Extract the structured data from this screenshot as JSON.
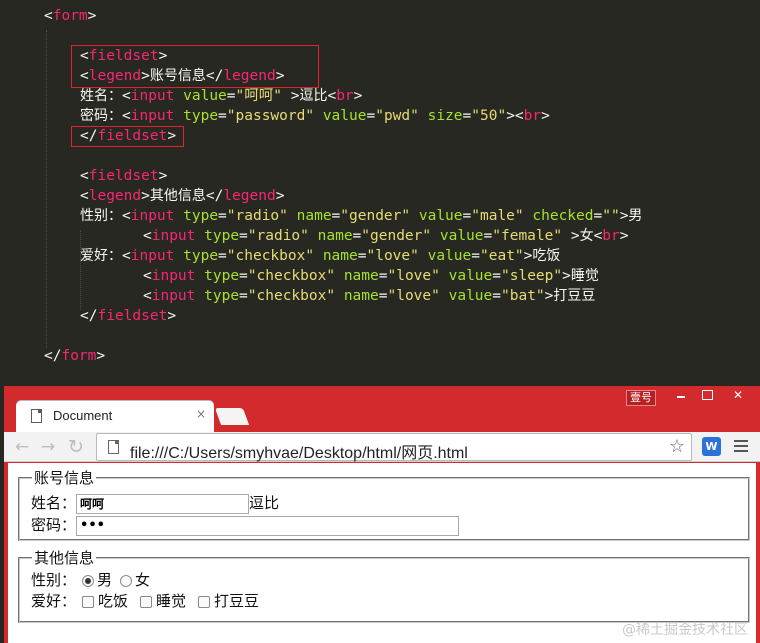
{
  "editor": {
    "lines": [
      {
        "parts": [
          [
            "p",
            "<"
          ],
          [
            "t",
            "form"
          ],
          [
            "p",
            ">"
          ]
        ]
      },
      {
        "parts": []
      },
      {
        "parts": [
          [
            "p",
            "<"
          ],
          [
            "t",
            "fieldset"
          ],
          [
            "p",
            ">"
          ]
        ]
      },
      {
        "parts": [
          [
            "p",
            "<"
          ],
          [
            "t",
            "legend"
          ],
          [
            "p",
            ">"
          ],
          [
            "tx",
            "账号信息"
          ],
          [
            "p",
            "</"
          ],
          [
            "t",
            "legend"
          ],
          [
            "p",
            ">"
          ]
        ]
      },
      {
        "parts": [
          [
            "tx",
            "姓名："
          ],
          [
            "p",
            "<"
          ],
          [
            "t",
            "input"
          ],
          [
            "p",
            " "
          ],
          [
            "a",
            "value"
          ],
          [
            "p",
            "="
          ],
          [
            "s",
            "\"呵呵\""
          ],
          [
            "p",
            " >"
          ],
          [
            "tx",
            "逗比"
          ],
          [
            "p",
            "<"
          ],
          [
            "t",
            "br"
          ],
          [
            "p",
            ">"
          ]
        ]
      },
      {
        "parts": [
          [
            "tx",
            "密码："
          ],
          [
            "p",
            "<"
          ],
          [
            "t",
            "input"
          ],
          [
            "p",
            " "
          ],
          [
            "a",
            "type"
          ],
          [
            "p",
            "="
          ],
          [
            "s",
            "\"password\""
          ],
          [
            "p",
            " "
          ],
          [
            "a",
            "value"
          ],
          [
            "p",
            "="
          ],
          [
            "s",
            "\"pwd\""
          ],
          [
            "p",
            " "
          ],
          [
            "a",
            "size"
          ],
          [
            "p",
            "="
          ],
          [
            "s",
            "\"50\""
          ],
          [
            "p",
            "><"
          ],
          [
            "t",
            "br"
          ],
          [
            "p",
            ">"
          ]
        ]
      },
      {
        "parts": [
          [
            "p",
            "</"
          ],
          [
            "t",
            "fieldset"
          ],
          [
            "p",
            ">"
          ]
        ]
      },
      {
        "parts": []
      },
      {
        "parts": [
          [
            "p",
            "<"
          ],
          [
            "t",
            "fieldset"
          ],
          [
            "p",
            ">"
          ]
        ]
      },
      {
        "parts": [
          [
            "p",
            "<"
          ],
          [
            "t",
            "legend"
          ],
          [
            "p",
            ">"
          ],
          [
            "tx",
            "其他信息"
          ],
          [
            "p",
            "</"
          ],
          [
            "t",
            "legend"
          ],
          [
            "p",
            ">"
          ]
        ]
      },
      {
        "parts": [
          [
            "tx",
            "性别："
          ],
          [
            "p",
            "<"
          ],
          [
            "t",
            "input"
          ],
          [
            "p",
            " "
          ],
          [
            "a",
            "type"
          ],
          [
            "p",
            "="
          ],
          [
            "s",
            "\"radio\""
          ],
          [
            "p",
            " "
          ],
          [
            "a",
            "name"
          ],
          [
            "p",
            "="
          ],
          [
            "s",
            "\"gender\""
          ],
          [
            "p",
            " "
          ],
          [
            "a",
            "value"
          ],
          [
            "p",
            "="
          ],
          [
            "s",
            "\"male\""
          ],
          [
            "p",
            " "
          ],
          [
            "a",
            "checked"
          ],
          [
            "p",
            "="
          ],
          [
            "s",
            "\"\""
          ],
          [
            "p",
            ">"
          ],
          [
            "tx",
            "男"
          ]
        ]
      },
      {
        "parts": [
          [
            "p",
            "<"
          ],
          [
            "t",
            "input"
          ],
          [
            "p",
            " "
          ],
          [
            "a",
            "type"
          ],
          [
            "p",
            "="
          ],
          [
            "s",
            "\"radio\""
          ],
          [
            "p",
            " "
          ],
          [
            "a",
            "name"
          ],
          [
            "p",
            "="
          ],
          [
            "s",
            "\"gender\""
          ],
          [
            "p",
            " "
          ],
          [
            "a",
            "value"
          ],
          [
            "p",
            "="
          ],
          [
            "s",
            "\"female\""
          ],
          [
            "p",
            " >"
          ],
          [
            "tx",
            "女"
          ],
          [
            "p",
            "<"
          ],
          [
            "t",
            "br"
          ],
          [
            "p",
            ">"
          ]
        ]
      },
      {
        "parts": [
          [
            "tx",
            "爱好："
          ],
          [
            "p",
            "<"
          ],
          [
            "t",
            "input"
          ],
          [
            "p",
            " "
          ],
          [
            "a",
            "type"
          ],
          [
            "p",
            "="
          ],
          [
            "s",
            "\"checkbox\""
          ],
          [
            "p",
            " "
          ],
          [
            "a",
            "name"
          ],
          [
            "p",
            "="
          ],
          [
            "s",
            "\"love\""
          ],
          [
            "p",
            " "
          ],
          [
            "a",
            "value"
          ],
          [
            "p",
            "="
          ],
          [
            "s",
            "\"eat\""
          ],
          [
            "p",
            ">"
          ],
          [
            "tx",
            "吃饭"
          ]
        ]
      },
      {
        "parts": [
          [
            "p",
            "<"
          ],
          [
            "t",
            "input"
          ],
          [
            "p",
            " "
          ],
          [
            "a",
            "type"
          ],
          [
            "p",
            "="
          ],
          [
            "s",
            "\"checkbox\""
          ],
          [
            "p",
            " "
          ],
          [
            "a",
            "name"
          ],
          [
            "p",
            "="
          ],
          [
            "s",
            "\"love\""
          ],
          [
            "p",
            " "
          ],
          [
            "a",
            "value"
          ],
          [
            "p",
            "="
          ],
          [
            "s",
            "\"sleep\""
          ],
          [
            "p",
            ">"
          ],
          [
            "tx",
            "睡觉"
          ]
        ]
      },
      {
        "parts": [
          [
            "p",
            "<"
          ],
          [
            "t",
            "input"
          ],
          [
            "p",
            " "
          ],
          [
            "a",
            "type"
          ],
          [
            "p",
            "="
          ],
          [
            "s",
            "\"checkbox\""
          ],
          [
            "p",
            " "
          ],
          [
            "a",
            "name"
          ],
          [
            "p",
            "="
          ],
          [
            "s",
            "\"love\""
          ],
          [
            "p",
            " "
          ],
          [
            "a",
            "value"
          ],
          [
            "p",
            "="
          ],
          [
            "s",
            "\"bat\""
          ],
          [
            "p",
            ">"
          ],
          [
            "tx",
            "打豆豆"
          ]
        ]
      },
      {
        "parts": [
          [
            "p",
            "</"
          ],
          [
            "t",
            "fieldset"
          ],
          [
            "p",
            ">"
          ]
        ]
      },
      {
        "parts": []
      },
      {
        "parts": [
          [
            "p",
            "</"
          ],
          [
            "t",
            "form"
          ],
          [
            "p",
            ">"
          ]
        ]
      }
    ],
    "highlight_color": "#e0242b"
  },
  "browser": {
    "user_button": "壹号",
    "tab_title": "Document",
    "tab_close": "×",
    "url": "file:///C:/Users/smyhvae/Desktop/html/网页.html",
    "extension_label": "W",
    "accent_color": "#d32a2d"
  },
  "form": {
    "fieldset1": {
      "legend": "账号信息",
      "name_label": "姓名：",
      "name_value": "呵呵",
      "name_suffix": "逗比",
      "password_label": "密码：",
      "password_value": "•••"
    },
    "fieldset2": {
      "legend": "其他信息",
      "gender_label": "性别：",
      "male": "男",
      "female": "女",
      "male_checked": true,
      "hobby_label": "爱好：",
      "hobbies": [
        "吃饭",
        "睡觉",
        "打豆豆"
      ]
    }
  },
  "watermark": "@稀土掘金技术社区"
}
